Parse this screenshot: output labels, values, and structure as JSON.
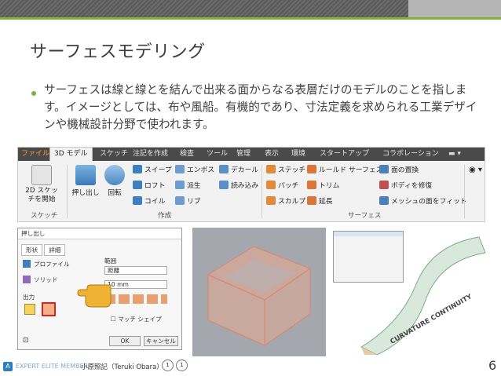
{
  "slide": {
    "title": "サーフェスモデリング",
    "bullet": "サーフェスは線と線とを結んで出来る面からなる表層だけのモデルのことを指します。イメージとしては、布や風船。有機的であり、寸法定義を求められる工業デザインや機械設計分野で使われます。",
    "page_number": "6"
  },
  "ribbon": {
    "tabs": [
      "ファイル",
      "3D モデル",
      "スケッチ",
      "注記を作成",
      "検査",
      "ツール",
      "管理",
      "表示",
      "環境",
      "スタートアップ",
      "コラボレーション"
    ],
    "groups": {
      "sketch": {
        "label": "スケッチ",
        "button": "2D スケッチを開始"
      },
      "create": {
        "label": "作成",
        "big_buttons": [
          "押し出し",
          "回転"
        ],
        "col1": [
          "スイープ",
          "ロフト",
          "コイル"
        ],
        "col2": [
          "エンボス",
          "派生",
          "リブ"
        ],
        "col3": [
          "デカール",
          "読み込み"
        ]
      },
      "surface": {
        "label": "サーフェス",
        "col1": [
          "ステッチ",
          "パッチ",
          "スカルプ"
        ],
        "col2": [
          "ルールド サーフェス",
          "トリム",
          "延長"
        ],
        "col3": [
          "面の置換",
          "ボディを修復",
          "メッシュの面をフィット"
        ]
      }
    }
  },
  "extrude_dialog": {
    "title": "押し出し",
    "tabs": [
      "形状",
      "詳細"
    ],
    "profile_label": "プロファイル",
    "solid_label": "ソリッド",
    "output_label": "出力",
    "range_label": "範囲",
    "range_value": "距離",
    "distance_value": "10 mm",
    "match_shape": "マッチ シェイプ",
    "ok": "OK",
    "cancel": "キャンセル"
  },
  "curvature_text": "CURVATURE CONTINUITY",
  "footer": {
    "member": "EXPERT ELITE MEMBER",
    "name": "小原照記（Teruki Obara）"
  },
  "colors": {
    "accent_green": "#7fb23a",
    "ribbon_tab_dark": "#4a4a4a",
    "file_tab": "#ff9a2e"
  }
}
